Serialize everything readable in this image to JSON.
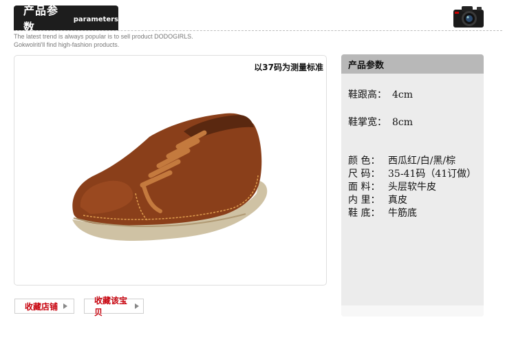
{
  "header": {
    "title_cn": "产品参数",
    "title_en": "parameters",
    "tagline_line1": "The latest trend is always popular is to sell product DODOGIRLS.",
    "tagline_line2": "Gokwolriti'll find high-fashion products."
  },
  "photo": {
    "size_note": "以37码为测量标准"
  },
  "buttons": {
    "favorite_store": "收藏店铺",
    "favorite_item": "收藏该宝贝"
  },
  "panel": {
    "title": "产品参数",
    "heel_height_label": "鞋跟高：",
    "heel_height_value": "4cm",
    "sole_width_label": "鞋掌宽：",
    "sole_width_value": "8cm",
    "specs": [
      {
        "label": "颜 色：",
        "value": "西瓜红/白/黑/棕"
      },
      {
        "label": "尺 码：",
        "value": "35-41码（41订做）"
      },
      {
        "label": "面 料：",
        "value": "头层软牛皮"
      },
      {
        "label": "内 里：",
        "value": "真皮"
      },
      {
        "label": "鞋 底：",
        "value": "牛筋底"
      }
    ]
  },
  "colors": {
    "header_bg": "#1d1d1d",
    "button_text": "#c7000b",
    "panel_bg": "#ececec",
    "panel_head_bg": "#b8b8b8",
    "shoe_leather": "#8a3f1a"
  },
  "icons": {
    "camera": "camera-icon",
    "button_arrow": "triangle-right-icon"
  }
}
